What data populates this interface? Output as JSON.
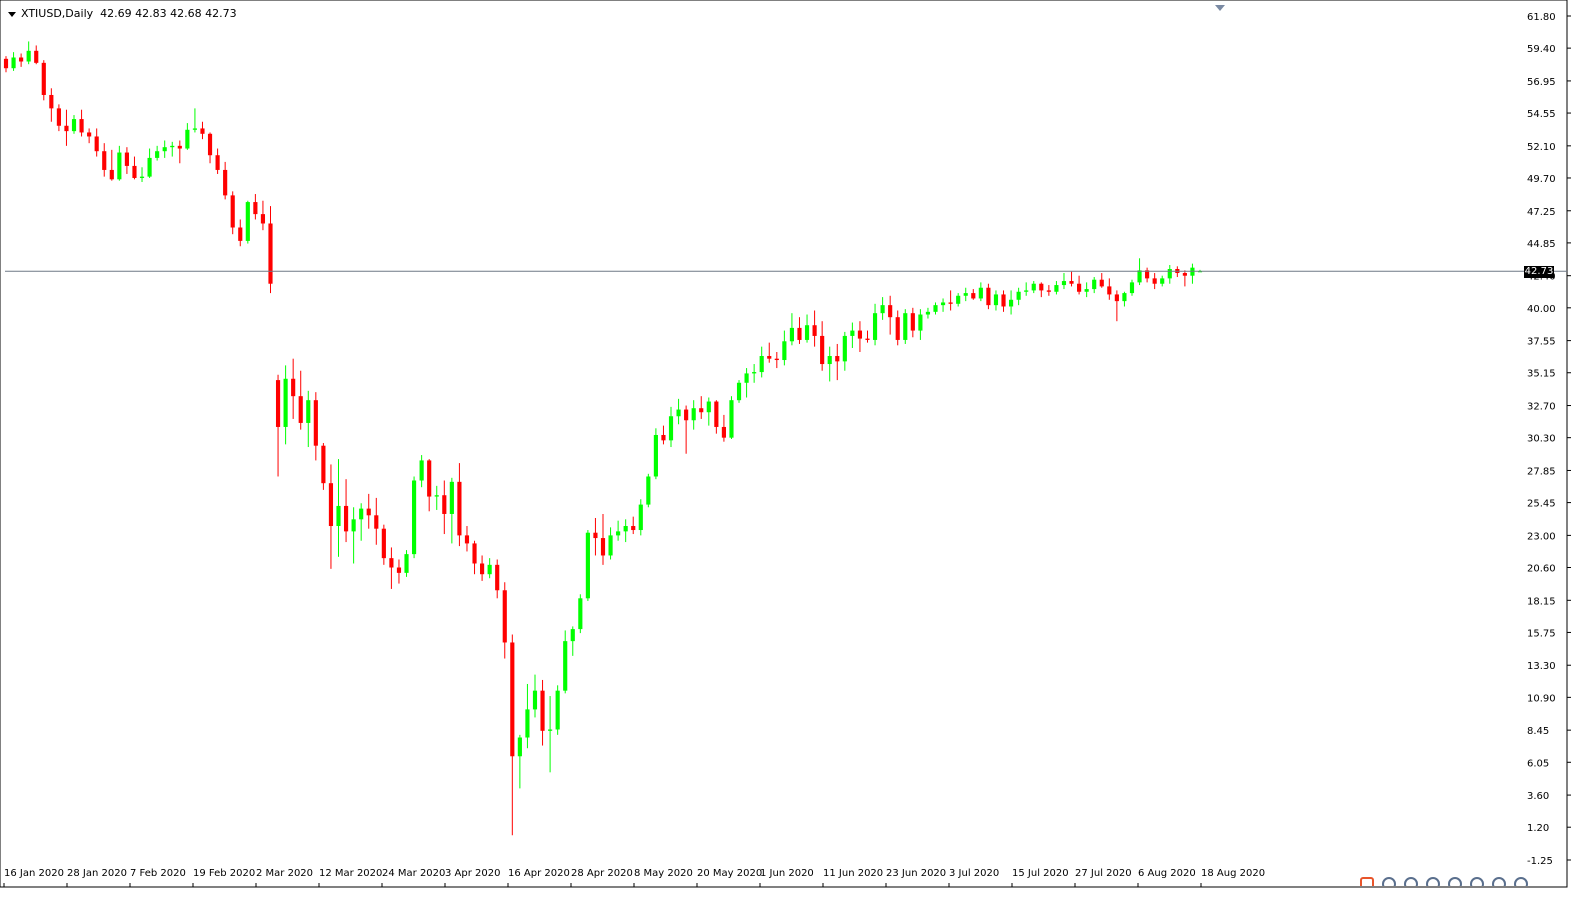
{
  "header": {
    "symbol_timeframe": "XTIUSD,Daily",
    "ohlc": "42.69 42.83 42.68 42.73"
  },
  "current_price_label": "42.73",
  "colors": {
    "bull": "#00ff00",
    "bear": "#ff0000",
    "background": "#ffffff",
    "axis": "#000000",
    "price_line": "#6e7886"
  },
  "tray_icons": [
    "app-icon",
    "chart-icon",
    "chart-icon",
    "globe-icon",
    "globe-icon",
    "globe-icon",
    "globe-icon",
    "globe-icon"
  ],
  "chart_data": {
    "type": "candlestick",
    "y_ticks": [
      "61.80",
      "59.40",
      "56.95",
      "54.55",
      "52.10",
      "49.70",
      "47.25",
      "44.85",
      "42.40",
      "40.00",
      "37.55",
      "35.15",
      "32.70",
      "30.30",
      "27.85",
      "25.45",
      "23.00",
      "20.60",
      "18.15",
      "15.75",
      "13.30",
      "10.90",
      "8.45",
      "6.05",
      "3.60",
      "1.20",
      "-1.25"
    ],
    "ylim": [
      -1.25,
      61.8
    ],
    "x_labels": [
      "16 Jan 2020",
      "28 Jan 2020",
      "7 Feb 2020",
      "19 Feb 2020",
      "2 Mar 2020",
      "12 Mar 2020",
      "24 Mar 2020",
      "3 Apr 2020",
      "16 Apr 2020",
      "28 Apr 2020",
      "8 May 2020",
      "20 May 2020",
      "1 Jun 2020",
      "11 Jun 2020",
      "23 Jun 2020",
      "3 Jul 2020",
      "15 Jul 2020",
      "27 Jul 2020",
      "6 Aug 2020",
      "18 Aug 2020"
    ],
    "current_price": 42.73,
    "candles": [
      [
        58.6,
        58.8,
        57.6,
        57.9
      ],
      [
        57.9,
        59.1,
        57.7,
        58.7
      ],
      [
        58.7,
        59.0,
        58.0,
        58.4
      ],
      [
        58.4,
        59.9,
        58.2,
        59.2
      ],
      [
        59.2,
        59.6,
        58.2,
        58.3
      ],
      [
        58.3,
        58.5,
        55.5,
        55.9
      ],
      [
        55.9,
        56.4,
        53.9,
        54.9
      ],
      [
        54.9,
        55.2,
        53.2,
        53.6
      ],
      [
        53.6,
        54.8,
        52.1,
        53.2
      ],
      [
        53.2,
        54.4,
        53.0,
        54.1
      ],
      [
        54.1,
        54.8,
        52.8,
        53.1
      ],
      [
        53.1,
        53.4,
        52.3,
        52.8
      ],
      [
        52.8,
        53.4,
        51.3,
        51.7
      ],
      [
        51.7,
        52.3,
        49.8,
        50.3
      ],
      [
        50.3,
        51.8,
        49.5,
        49.6
      ],
      [
        49.6,
        52.1,
        49.5,
        51.6
      ],
      [
        51.6,
        52.0,
        50.0,
        50.6
      ],
      [
        50.6,
        51.3,
        49.6,
        49.7
      ],
      [
        49.7,
        50.5,
        49.4,
        49.8
      ],
      [
        49.8,
        51.9,
        49.7,
        51.2
      ],
      [
        51.2,
        52.1,
        51.0,
        51.7
      ],
      [
        51.7,
        52.5,
        51.2,
        52.0
      ],
      [
        52.0,
        52.4,
        51.3,
        52.1
      ],
      [
        52.1,
        52.5,
        50.8,
        51.9
      ],
      [
        51.9,
        53.8,
        51.8,
        53.3
      ],
      [
        53.3,
        54.9,
        53.1,
        53.4
      ],
      [
        53.4,
        53.9,
        52.6,
        53.0
      ],
      [
        53.0,
        53.1,
        50.8,
        51.4
      ],
      [
        51.4,
        51.9,
        50.0,
        50.3
      ],
      [
        50.3,
        50.9,
        48.1,
        48.4
      ],
      [
        48.4,
        48.7,
        45.5,
        46.0
      ],
      [
        46.0,
        46.6,
        44.6,
        45.0
      ],
      [
        45.0,
        48.0,
        44.8,
        47.9
      ],
      [
        47.9,
        48.5,
        46.6,
        47.0
      ],
      [
        47.0,
        48.0,
        45.8,
        46.3
      ],
      [
        46.3,
        47.6,
        41.1,
        41.8
      ],
      [
        34.6,
        35.0,
        27.4,
        31.1
      ],
      [
        31.1,
        35.7,
        29.8,
        34.7
      ],
      [
        34.7,
        36.2,
        31.7,
        33.4
      ],
      [
        33.4,
        35.3,
        30.9,
        31.4
      ],
      [
        31.4,
        33.8,
        29.6,
        33.1
      ],
      [
        33.1,
        33.7,
        28.6,
        29.7
      ],
      [
        29.7,
        29.9,
        26.4,
        26.9
      ],
      [
        26.9,
        28.3,
        20.5,
        23.7
      ],
      [
        23.7,
        28.7,
        21.4,
        25.2
      ],
      [
        25.2,
        27.2,
        22.5,
        23.3
      ],
      [
        23.3,
        25.1,
        20.9,
        24.2
      ],
      [
        24.2,
        25.4,
        22.6,
        25.0
      ],
      [
        25.0,
        26.1,
        23.5,
        24.5
      ],
      [
        24.5,
        25.8,
        22.3,
        23.5
      ],
      [
        23.5,
        23.8,
        20.8,
        21.3
      ],
      [
        21.3,
        22.1,
        19.0,
        20.6
      ],
      [
        20.6,
        21.2,
        19.4,
        20.2
      ],
      [
        20.2,
        21.9,
        19.9,
        21.6
      ],
      [
        21.6,
        27.4,
        21.3,
        27.1
      ],
      [
        27.1,
        29.0,
        26.6,
        28.6
      ],
      [
        28.6,
        28.7,
        24.8,
        25.9
      ],
      [
        25.9,
        26.7,
        24.9,
        26.0
      ],
      [
        26.0,
        27.1,
        23.1,
        24.6
      ],
      [
        24.6,
        27.3,
        22.4,
        27.0
      ],
      [
        27.0,
        28.4,
        22.2,
        23.0
      ],
      [
        23.0,
        23.7,
        21.8,
        22.4
      ],
      [
        22.4,
        22.6,
        20.1,
        20.9
      ],
      [
        20.9,
        21.5,
        19.6,
        20.1
      ],
      [
        20.1,
        21.3,
        19.8,
        20.8
      ],
      [
        20.8,
        21.2,
        18.3,
        18.9
      ],
      [
        18.9,
        19.5,
        13.8,
        15.0
      ],
      [
        15.0,
        15.6,
        0.6,
        6.5
      ],
      [
        6.5,
        8.1,
        4.1,
        7.9
      ],
      [
        7.9,
        11.9,
        7.1,
        10.0
      ],
      [
        10.0,
        12.6,
        9.4,
        11.4
      ],
      [
        11.4,
        12.2,
        7.3,
        8.4
      ],
      [
        8.4,
        11.0,
        5.3,
        8.5
      ],
      [
        8.5,
        11.8,
        8.1,
        11.4
      ],
      [
        11.4,
        15.9,
        11.2,
        15.1
      ],
      [
        15.1,
        16.2,
        14.0,
        16.0
      ],
      [
        16.0,
        18.6,
        15.7,
        18.3
      ],
      [
        18.3,
        23.4,
        18.1,
        23.2
      ],
      [
        23.2,
        24.3,
        21.5,
        22.8
      ],
      [
        22.8,
        24.6,
        20.8,
        21.5
      ],
      [
        21.5,
        23.6,
        21.2,
        23.0
      ],
      [
        23.0,
        24.1,
        22.6,
        23.3
      ],
      [
        23.3,
        24.2,
        22.5,
        23.7
      ],
      [
        23.7,
        24.4,
        23.1,
        23.4
      ],
      [
        23.4,
        25.7,
        23.0,
        25.3
      ],
      [
        25.3,
        27.6,
        25.1,
        27.4
      ],
      [
        27.4,
        31.0,
        27.2,
        30.5
      ],
      [
        30.5,
        31.2,
        29.8,
        30.1
      ],
      [
        30.1,
        32.6,
        29.6,
        31.9
      ],
      [
        31.9,
        33.2,
        31.3,
        32.4
      ],
      [
        32.4,
        32.7,
        29.1,
        31.6
      ],
      [
        31.6,
        33.1,
        30.9,
        32.5
      ],
      [
        32.5,
        33.4,
        31.7,
        32.2
      ],
      [
        32.2,
        33.3,
        31.2,
        33.0
      ],
      [
        33.0,
        33.1,
        30.6,
        31.1
      ],
      [
        31.1,
        32.0,
        30.0,
        30.3
      ],
      [
        30.3,
        33.4,
        30.2,
        33.1
      ],
      [
        33.1,
        34.6,
        32.9,
        34.4
      ],
      [
        34.4,
        35.5,
        33.3,
        35.1
      ],
      [
        35.1,
        35.8,
        34.4,
        35.2
      ],
      [
        35.2,
        37.1,
        34.8,
        36.4
      ],
      [
        36.4,
        37.4,
        35.9,
        36.2
      ],
      [
        36.2,
        36.7,
        35.5,
        36.1
      ],
      [
        36.1,
        38.3,
        35.7,
        37.5
      ],
      [
        37.5,
        39.6,
        37.2,
        38.5
      ],
      [
        38.5,
        39.3,
        37.3,
        37.6
      ],
      [
        37.6,
        39.5,
        37.4,
        38.7
      ],
      [
        38.7,
        39.8,
        37.1,
        37.9
      ],
      [
        37.9,
        39.0,
        35.3,
        35.8
      ],
      [
        35.8,
        37.1,
        34.5,
        36.4
      ],
      [
        36.4,
        37.3,
        34.6,
        36.0
      ],
      [
        36.0,
        38.2,
        35.3,
        37.9
      ],
      [
        37.9,
        38.9,
        37.0,
        38.3
      ],
      [
        38.3,
        39.0,
        36.7,
        37.7
      ],
      [
        37.7,
        38.3,
        37.4,
        37.6
      ],
      [
        37.6,
        40.3,
        37.2,
        39.6
      ],
      [
        39.6,
        40.8,
        39.1,
        40.2
      ],
      [
        40.2,
        40.9,
        38.0,
        39.3
      ],
      [
        39.3,
        39.8,
        37.2,
        37.6
      ],
      [
        37.6,
        39.9,
        37.3,
        39.6
      ],
      [
        39.6,
        40.0,
        37.8,
        38.3
      ],
      [
        38.3,
        39.9,
        37.6,
        39.5
      ],
      [
        39.5,
        40.0,
        39.2,
        39.7
      ],
      [
        39.7,
        40.4,
        39.5,
        40.2
      ],
      [
        40.2,
        40.7,
        39.7,
        40.4
      ],
      [
        40.4,
        41.3,
        39.8,
        40.3
      ],
      [
        40.3,
        41.1,
        40.1,
        40.9
      ],
      [
        40.9,
        41.5,
        40.5,
        41.1
      ],
      [
        41.1,
        41.4,
        40.6,
        40.7
      ],
      [
        40.7,
        41.9,
        40.5,
        41.5
      ],
      [
        41.5,
        41.8,
        39.9,
        40.2
      ],
      [
        40.2,
        41.3,
        39.8,
        41.0
      ],
      [
        41.0,
        41.3,
        39.7,
        40.1
      ],
      [
        40.1,
        41.3,
        39.5,
        40.6
      ],
      [
        40.6,
        41.5,
        40.2,
        41.2
      ],
      [
        41.2,
        41.9,
        40.9,
        41.3
      ],
      [
        41.3,
        42.0,
        41.1,
        41.8
      ],
      [
        41.8,
        41.9,
        40.8,
        41.3
      ],
      [
        41.3,
        41.7,
        40.9,
        41.2
      ],
      [
        41.2,
        42.0,
        41.0,
        41.7
      ],
      [
        41.7,
        42.6,
        41.4,
        42.0
      ],
      [
        42.0,
        42.7,
        41.6,
        41.8
      ],
      [
        41.8,
        42.4,
        41.0,
        41.2
      ],
      [
        41.2,
        41.9,
        40.8,
        41.4
      ],
      [
        41.4,
        42.3,
        41.1,
        42.1
      ],
      [
        42.1,
        42.6,
        41.5,
        41.6
      ],
      [
        41.6,
        42.2,
        40.6,
        41.0
      ],
      [
        41.0,
        41.3,
        39.0,
        40.5
      ],
      [
        40.5,
        41.2,
        40.1,
        41.1
      ],
      [
        41.1,
        42.1,
        40.9,
        41.9
      ],
      [
        41.9,
        43.7,
        41.7,
        42.8
      ],
      [
        42.8,
        43.0,
        41.9,
        42.2
      ],
      [
        42.2,
        42.6,
        41.4,
        41.8
      ],
      [
        41.8,
        42.4,
        41.6,
        42.2
      ],
      [
        42.2,
        43.2,
        41.8,
        42.9
      ],
      [
        42.9,
        43.1,
        42.3,
        42.6
      ],
      [
        42.6,
        42.8,
        41.6,
        42.4
      ],
      [
        42.4,
        43.3,
        41.8,
        43.0
      ],
      [
        42.69,
        42.83,
        42.68,
        42.73
      ]
    ]
  }
}
